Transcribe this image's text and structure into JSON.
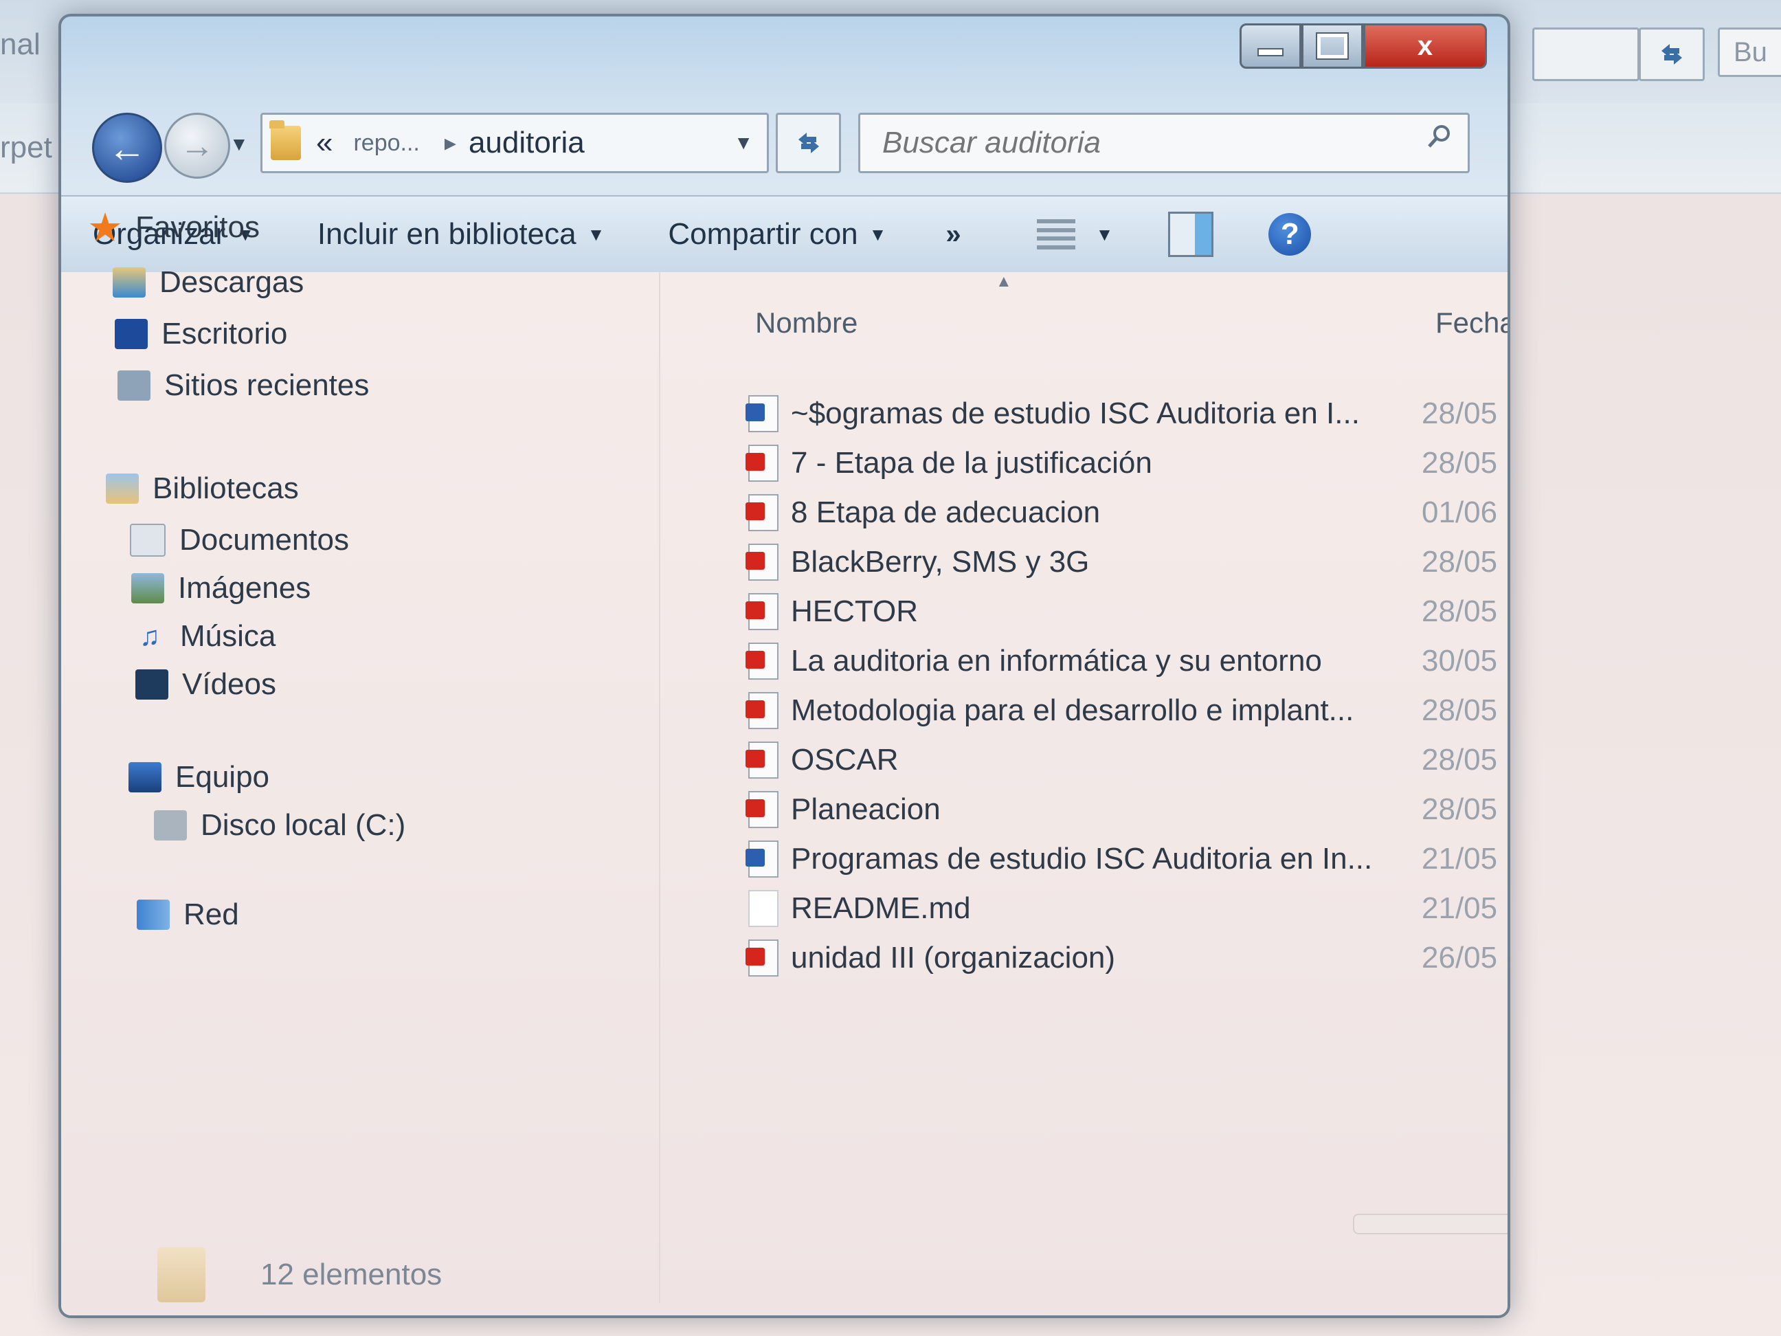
{
  "window": {
    "close_glyph": "x"
  },
  "address": {
    "overflow": "«",
    "crumb1": "repo...",
    "separator": "▸",
    "crumb2": "auditoria"
  },
  "search": {
    "placeholder": "Buscar auditoria"
  },
  "toolbar": {
    "organize": "Organizar",
    "include_library": "Incluir en biblioteca",
    "share": "Compartir con",
    "more": "»",
    "help": "?"
  },
  "nav": {
    "favorites": "Favoritos",
    "downloads": "Descargas",
    "desktop": "Escritorio",
    "recent": "Sitios recientes",
    "libraries": "Bibliotecas",
    "documents": "Documentos",
    "images": "Imágenes",
    "music": "Música",
    "videos": "Vídeos",
    "computer": "Equipo",
    "local_disk": "Disco local (C:)",
    "network": "Red"
  },
  "columns": {
    "name": "Nombre",
    "date": "Fecha"
  },
  "files": [
    {
      "name": "~$ogramas de estudio ISC Auditoria en I...",
      "date": "28/05/",
      "type": "doc"
    },
    {
      "name": "7 - Etapa de la justificación",
      "date": "28/05/",
      "type": "pdf"
    },
    {
      "name": "8 Etapa de adecuacion",
      "date": "01/06/",
      "type": "pdf"
    },
    {
      "name": "BlackBerry, SMS y 3G",
      "date": "28/05/",
      "type": "pdf"
    },
    {
      "name": "HECTOR",
      "date": "28/05/",
      "type": "pdf"
    },
    {
      "name": "La auditoria en informática y su entorno",
      "date": "30/05/",
      "type": "pdf"
    },
    {
      "name": "Metodologia para el desarrollo e implant...",
      "date": "28/05/",
      "type": "pdf"
    },
    {
      "name": "OSCAR",
      "date": "28/05/",
      "type": "pdf"
    },
    {
      "name": "Planeacion",
      "date": "28/05/",
      "type": "pdf"
    },
    {
      "name": "Programas de estudio ISC Auditoria en In...",
      "date": "21/05/",
      "type": "doc"
    },
    {
      "name": "README.md",
      "date": "21/05/",
      "type": "txt"
    },
    {
      "name": "unidad III (organizacion)",
      "date": "26/05/",
      "type": "pdf"
    }
  ],
  "status": {
    "count": "12 elementos"
  },
  "background": {
    "left_text_1": "nal",
    "left_text_2": "rpet",
    "search_fragment": "Bu"
  }
}
